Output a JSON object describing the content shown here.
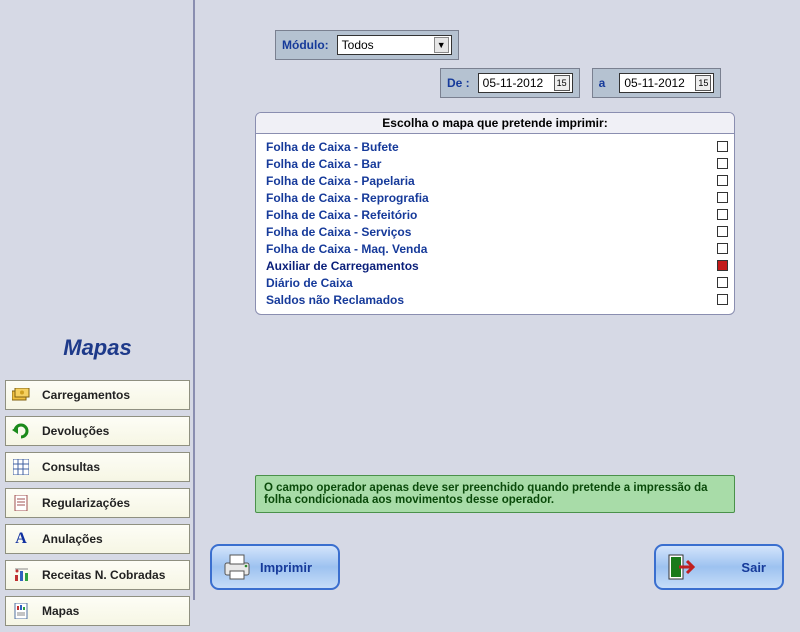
{
  "sidebar": {
    "title": "Mapas",
    "items": [
      {
        "label": "Carregamentos",
        "icon": "money-icon"
      },
      {
        "label": "Devoluções",
        "icon": "return-icon"
      },
      {
        "label": "Consultas",
        "icon": "grid-icon"
      },
      {
        "label": "Regularizações",
        "icon": "document-icon"
      },
      {
        "label": "Anulações",
        "icon": "letter-a-icon"
      },
      {
        "label": "Receitas N. Cobradas",
        "icon": "chart-icon"
      },
      {
        "label": "Mapas",
        "icon": "report-icon"
      }
    ]
  },
  "filters": {
    "modulo_label": "Módulo:",
    "modulo_value": "Todos",
    "de_label": "De :",
    "de_value": "05-11-2012",
    "a_label": "a",
    "a_value": "05-11-2012"
  },
  "list": {
    "header": "Escolha o mapa que pretende imprimir:",
    "items": [
      {
        "label": "Folha de Caixa - Bufete",
        "checked": false
      },
      {
        "label": "Folha de Caixa - Bar",
        "checked": false
      },
      {
        "label": "Folha de Caixa - Papelaria",
        "checked": false
      },
      {
        "label": "Folha de Caixa - Reprografia",
        "checked": false
      },
      {
        "label": "Folha de Caixa - Refeitório",
        "checked": false
      },
      {
        "label": "Folha de Caixa - Serviços",
        "checked": false
      },
      {
        "label": "Folha de Caixa - Maq. Venda",
        "checked": false
      },
      {
        "label": "Auxiliar de Carregamentos",
        "checked": true
      },
      {
        "label": "Diário de Caixa",
        "checked": false
      },
      {
        "label": "Saldos não Reclamados",
        "checked": false
      }
    ]
  },
  "info_text": "O campo operador apenas deve ser preenchido quando pretende a impressão da folha condicionada aos movimentos desse operador.",
  "buttons": {
    "print": "Imprimir",
    "exit": "Sair"
  }
}
